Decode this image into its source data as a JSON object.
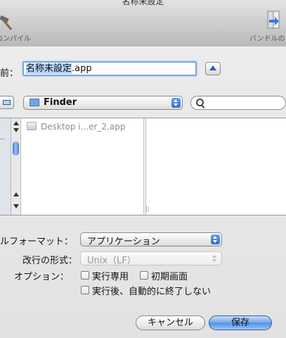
{
  "window": {
    "title": "名称未設定",
    "toolbar_left_label": "コンパイル",
    "toolbar_right_label": "バンドルの"
  },
  "save_sheet": {
    "name_label": "前：",
    "filename_base": "名称未設定",
    "filename_ext": ".app",
    "location": "Finder",
    "search_value": "",
    "file_list": [
      "Desktop i...er_2.app"
    ],
    "sidebar_fragment": "..",
    "format_label": "ルフォーマット：",
    "format_value": "アプリケーション",
    "line_ending_label": "改行の形式：",
    "line_ending_value": "Unix（LF）",
    "options_label": "オプション：",
    "options": [
      {
        "label": "実行専用",
        "checked": false
      },
      {
        "label": "初期画面",
        "checked": false
      },
      {
        "label": "実行後、自動的に終了しない",
        "checked": false
      }
    ],
    "cancel_label": "キャンセル",
    "save_label": "保存"
  },
  "colors": {
    "accent": "#4e8fe2",
    "selection": "#b5d3fc"
  }
}
